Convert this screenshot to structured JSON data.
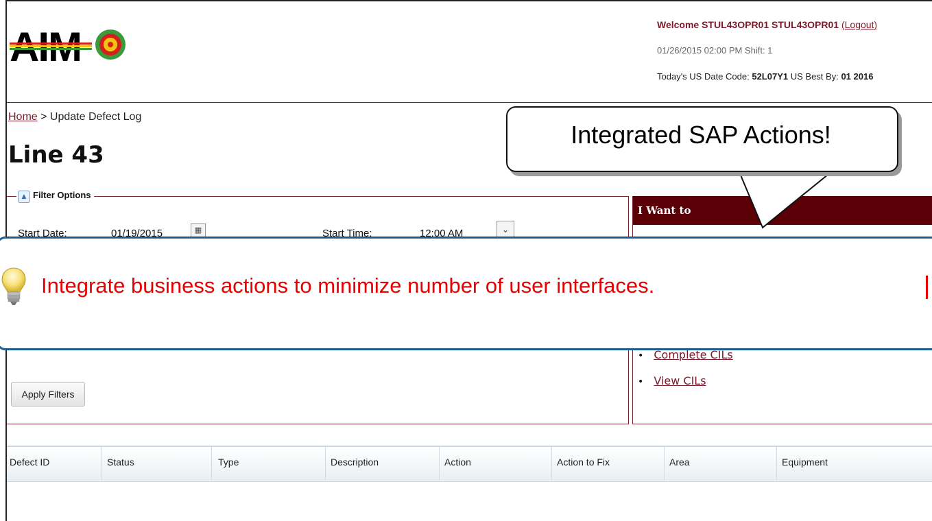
{
  "header": {
    "logo_text": "AIM",
    "welcome_prefix": "Welcome STUL43OPR01 STUL43OPR01",
    "logout_label": "(Logout)",
    "datetime": "01/26/2015 02:00 PM Shift: 1",
    "datecode_prefix": "Today's US Date Code:",
    "datecode_value": "52L07Y1",
    "bestby_prefix": "US Best By:",
    "bestby_value": "01 2016"
  },
  "breadcrumb": {
    "home": "Home",
    "separator": " > ",
    "current": "Update Defect Log"
  },
  "page_title": "Line 43",
  "filter": {
    "label": "Filter Options",
    "start_date_label": "Start Date:",
    "start_date_value": "01/19/2015",
    "start_time_label": "Start Time:",
    "start_time_value": "12:00 AM",
    "apply_label": "Apply Filters"
  },
  "iwant": {
    "title": "I Want to",
    "links": [
      "Complete CILs",
      "View CILs"
    ]
  },
  "table": {
    "columns": [
      "Defect ID",
      "Status",
      "Type",
      "Description",
      "Action",
      "Action to Fix",
      "Area",
      "Equipment"
    ]
  },
  "callout": {
    "text": "Integrated SAP Actions!"
  },
  "tip": {
    "text": "Integrate business actions to minimize number of user interfaces."
  },
  "colors": {
    "brand_maroon": "#5c0007",
    "link": "#7a1a2a",
    "tip_red": "#e60000",
    "tip_border": "#1e5d92"
  }
}
